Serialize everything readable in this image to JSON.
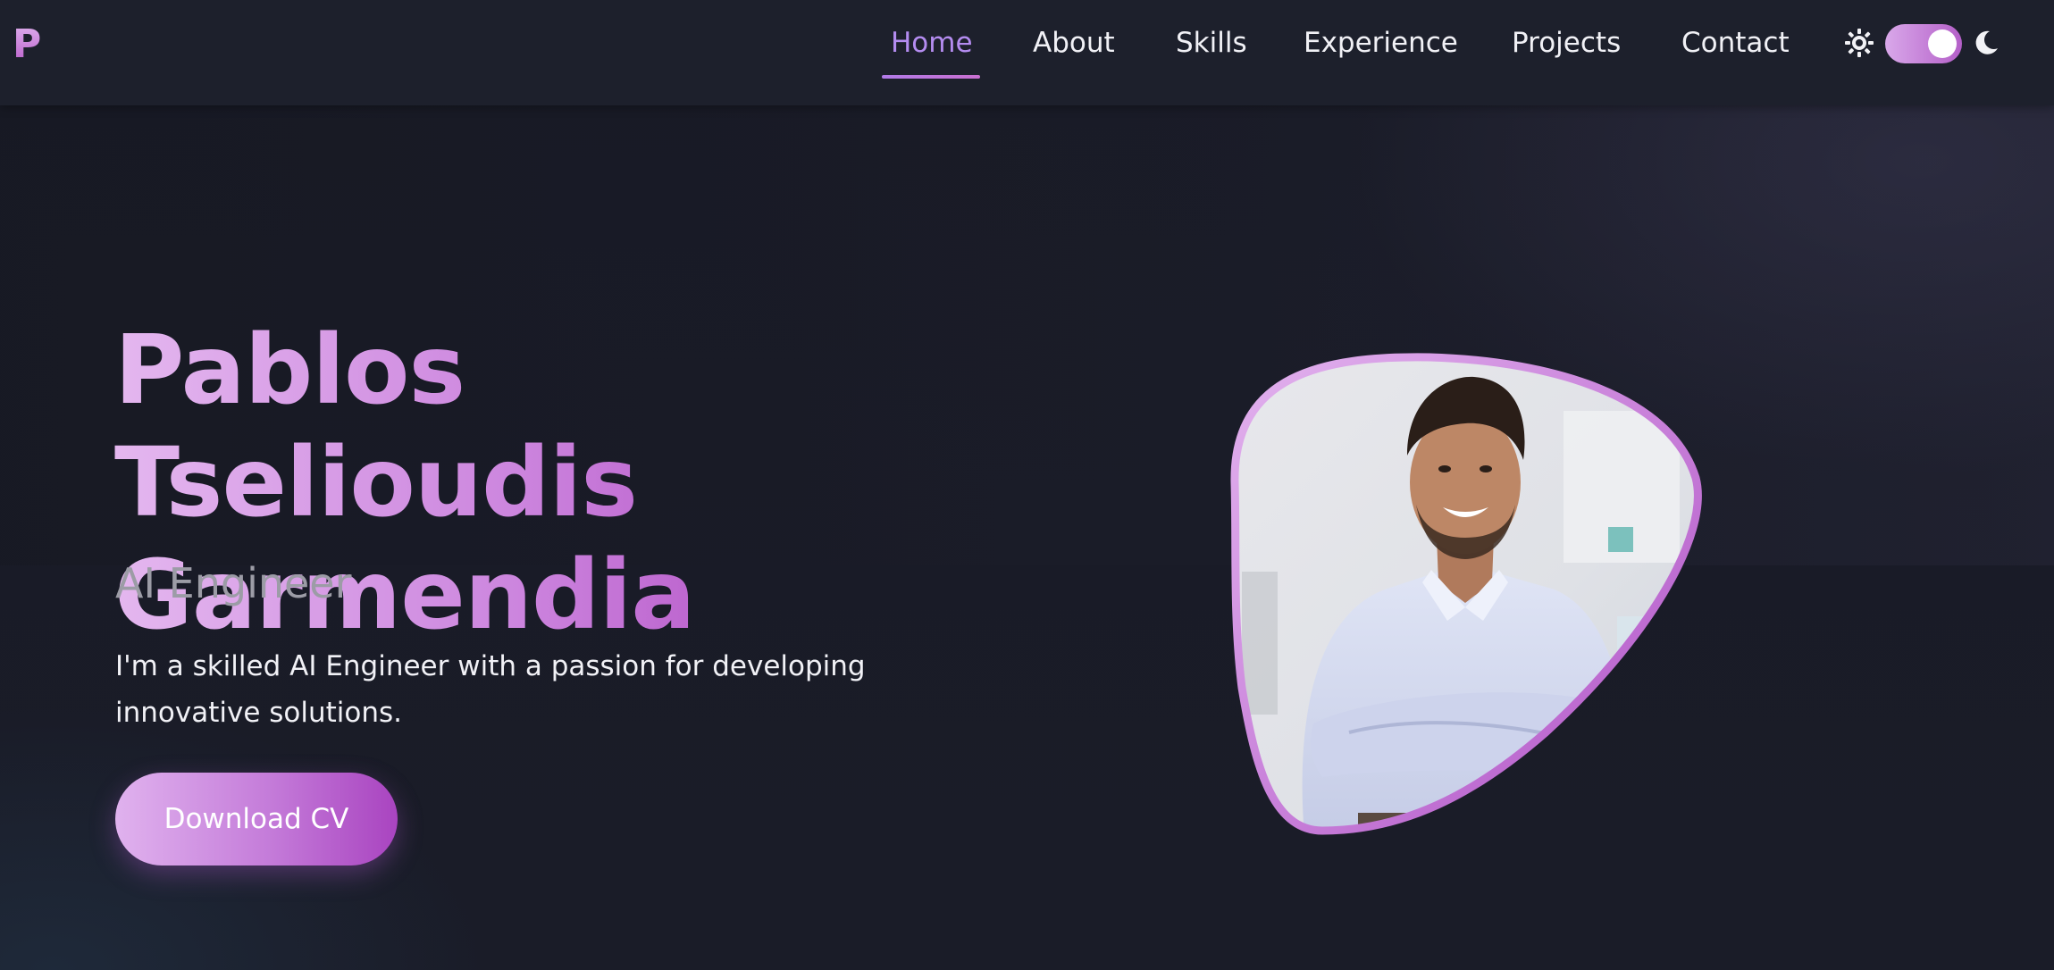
{
  "navbar": {
    "logo": "P",
    "items": [
      {
        "label": "Home",
        "active": true
      },
      {
        "label": "About"
      },
      {
        "label": "Skills"
      },
      {
        "label": "Experience"
      },
      {
        "label": "Projects"
      },
      {
        "label": "Contact"
      }
    ],
    "theme_toggle": {
      "state": "dark",
      "icons": [
        "sun-icon",
        "moon-icon"
      ]
    }
  },
  "hero": {
    "name_line1": "Pablos Tselioudis",
    "name_line2": "Garmendia",
    "role": "AI Engineer",
    "description": "I'm a skilled AI Engineer with a passion for developing innovative solutions.",
    "cta_label": "Download CV"
  },
  "colors": {
    "background": "#181a25",
    "navbar": "#1d202c",
    "accent_active": "#b48cf0",
    "gradient_start": "#e4b7ef",
    "gradient_end": "#a944c0",
    "muted_text": "#9c9ca6"
  }
}
